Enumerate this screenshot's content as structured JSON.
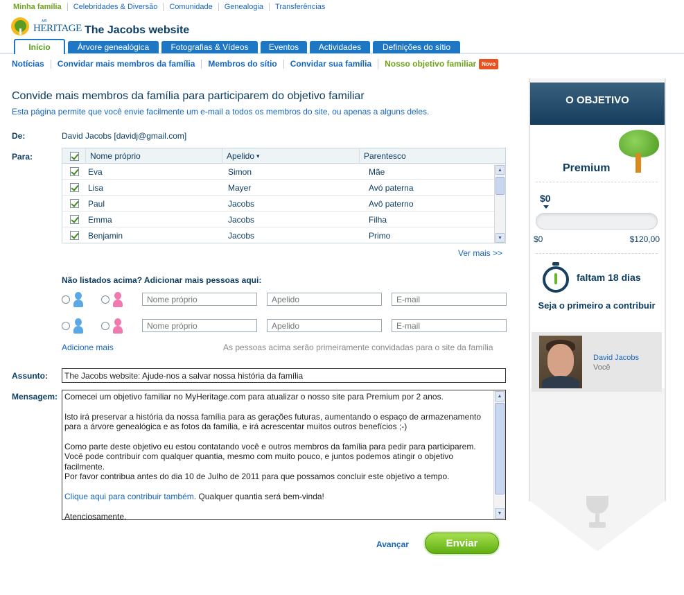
{
  "topnav": [
    "Minha família",
    "Celebridades & Diversão",
    "Comunidade",
    "Genealogia",
    "Transferências"
  ],
  "logo": {
    "my": "MY",
    "heritage": "HERITAGE"
  },
  "site_title": "The Jacobs website",
  "tabs": [
    "Início",
    "Árvore genealógica",
    "Fotografias & Vídeos",
    "Eventos",
    "Actividades",
    "Definições do sítio"
  ],
  "subnav": [
    "Notícias",
    "Convidar mais membros da família",
    "Membros do sítio",
    "Convidar sua família",
    "Nosso objetivo familiar"
  ],
  "new_badge": "Novo",
  "page_title": "Convide mais membros da família para participarem do objetivo familiar",
  "page_desc": "Esta página permite que você envie facilmente um e-mail a todos os membros do site, ou apenas a alguns deles.",
  "from_label": "De:",
  "from_value": "David Jacobs [davidj@gmail.com]",
  "to_label": "Para:",
  "table": {
    "headers": [
      "Nome próprio",
      "Apelido",
      "Parentesco"
    ],
    "sort_indicator": "▾",
    "rows": [
      {
        "first": "Eva",
        "last": "Simon",
        "rel": "Mãe"
      },
      {
        "first": "Lisa",
        "last": "Mayer",
        "rel": "Avó paterna"
      },
      {
        "first": "Paul",
        "last": "Jacobs",
        "rel": "Avô paterno"
      },
      {
        "first": "Emma",
        "last": "Jacobs",
        "rel": "Filha"
      },
      {
        "first": "Benjamin",
        "last": "Jacobs",
        "rel": "Primo"
      }
    ]
  },
  "see_more": "Ver mais >>",
  "add_title": "Não listados acima? Adicionar mais pessoas aqui:",
  "placeholders": {
    "first": "Nome próprio",
    "last": "Apelido",
    "email": "E-mail"
  },
  "add_more": "Adicione mais",
  "add_note": "As pessoas acima serão primeiramente convidadas para o site da família",
  "subject_label": "Assunto:",
  "subject_value": "The Jacobs website: Ajude-nos a salvar nossa história da família",
  "message_label": "Mensagem:",
  "message": {
    "p1": "Comecei um objetivo familiar no MyHeritage.com para atualizar o nosso site para Premium por 2 anos.",
    "p2": "Isto irá preservar a história da nossa família para as gerações futuras, aumentando o espaço de armazenamento para a árvore genealógica e as fotos da família, e irá acrescentar muitos outros benefícios ;-)",
    "p3": "Como parte deste objetivo eu estou contatando você e outros membros da família para pedir para participarem. Você pode contribuir com qualquer quantia, mesmo com muito pouco, e juntos podemos atingir o objetivo facilmente.",
    "p4": "Por favor contribua antes do dia 10 de Julho de 2011 para que possamos concluir este objetivo a tempo.",
    "link": "Clique aqui para contribuir também",
    "after_link": ". Qualquer quantia será bem-vinda!",
    "sign": "Atenciosamente,"
  },
  "advance": "Avançar",
  "send": "Enviar",
  "sidebar": {
    "title": "O OBJETIVO",
    "plan": "Premium",
    "amount": "$0",
    "progress_fraction": 0,
    "min": "$0",
    "max": "$120,00",
    "days_left": "faltam 18 dias",
    "first_prompt": "Seja o primeiro a contribuir",
    "contributor_name": "David Jacobs",
    "contributor_you": "Você"
  },
  "colors": {
    "accent_blue": "#1d77c4",
    "accent_green": "#6ea31a",
    "navy": "#0d3d62",
    "badge": "#e8521f"
  }
}
